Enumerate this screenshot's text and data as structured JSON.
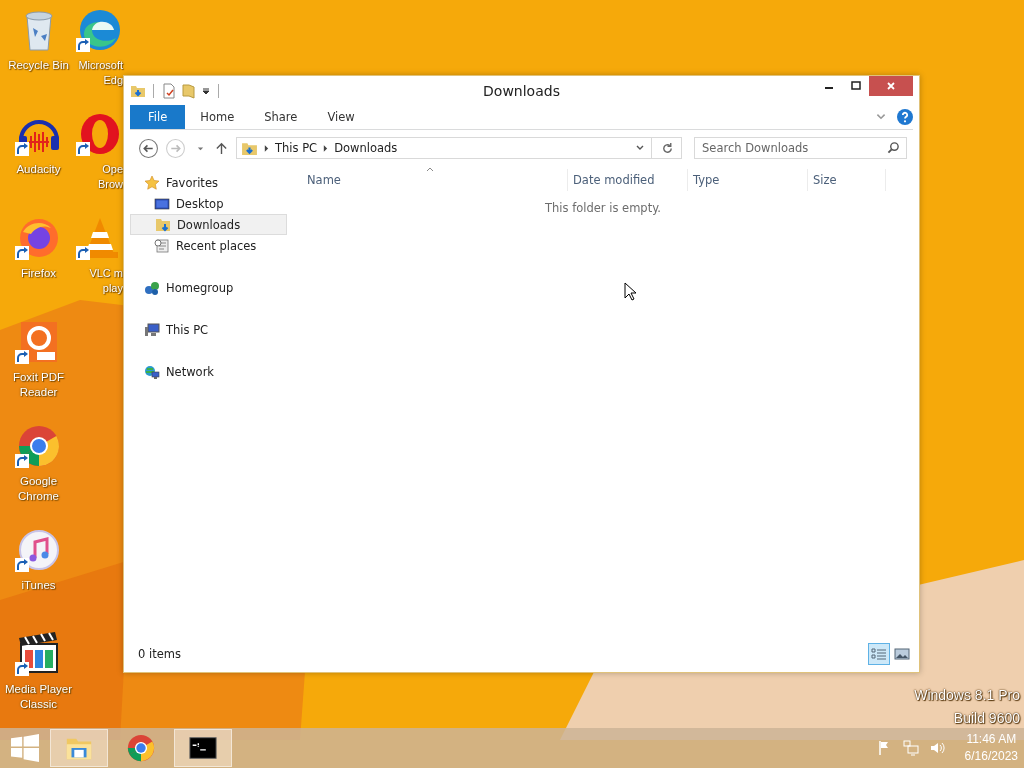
{
  "desktop": {
    "icons": [
      {
        "kind": "recycle-bin",
        "lines": [
          "Recycle Bin"
        ]
      },
      {
        "kind": "audacity",
        "lines": [
          "Audacity"
        ]
      },
      {
        "kind": "firefox",
        "lines": [
          "Firefox"
        ]
      },
      {
        "kind": "foxit",
        "lines": [
          "Foxit PDF",
          "Reader"
        ]
      },
      {
        "kind": "chrome",
        "lines": [
          "Google",
          "Chrome"
        ]
      },
      {
        "kind": "itunes",
        "lines": [
          "iTunes"
        ]
      },
      {
        "kind": "mpc",
        "lines": [
          "Media Player",
          "Classic"
        ]
      },
      {
        "kind": "edge",
        "lines": [
          "Microsoft",
          "Edg"
        ]
      },
      {
        "kind": "opera",
        "lines": [
          "Ope",
          "Brow"
        ]
      },
      {
        "kind": "vlc",
        "lines": [
          "VLC m",
          "play"
        ]
      }
    ],
    "watermark": [
      "Windows 8.1 Pro",
      "Build 9600"
    ]
  },
  "window": {
    "title": "Downloads",
    "ribbon_tabs": [
      {
        "label": "File",
        "selected": true
      },
      {
        "label": "Home",
        "selected": false
      },
      {
        "label": "Share",
        "selected": false
      },
      {
        "label": "View",
        "selected": false
      }
    ],
    "address": [
      "This PC",
      "Downloads"
    ],
    "search": {
      "placeholder": "Search Downloads"
    },
    "nav": [
      {
        "kind": "favorites",
        "label": "Favorites",
        "children": [
          {
            "kind": "desktop",
            "label": "Desktop",
            "selected": false
          },
          {
            "kind": "downloads",
            "label": "Downloads",
            "selected": true
          },
          {
            "kind": "recent",
            "label": "Recent places",
            "selected": false
          }
        ]
      },
      {
        "kind": "homegroup",
        "label": "Homegroup"
      },
      {
        "kind": "pc",
        "label": "This PC"
      },
      {
        "kind": "network",
        "label": "Network"
      }
    ],
    "columns": [
      "Name",
      "Date modified",
      "Type",
      "Size"
    ],
    "empty_message": "This folder is empty.",
    "status": "0 items",
    "views": [
      {
        "kind": "details",
        "selected": true
      },
      {
        "kind": "thumbnails",
        "selected": false
      }
    ]
  },
  "taskbar": {
    "items": [
      {
        "kind": "explorer",
        "running": true
      },
      {
        "kind": "chrome",
        "running": false
      },
      {
        "kind": "cmd",
        "running": true
      }
    ],
    "time": "11:46 AM",
    "date": "6/16/2023"
  }
}
